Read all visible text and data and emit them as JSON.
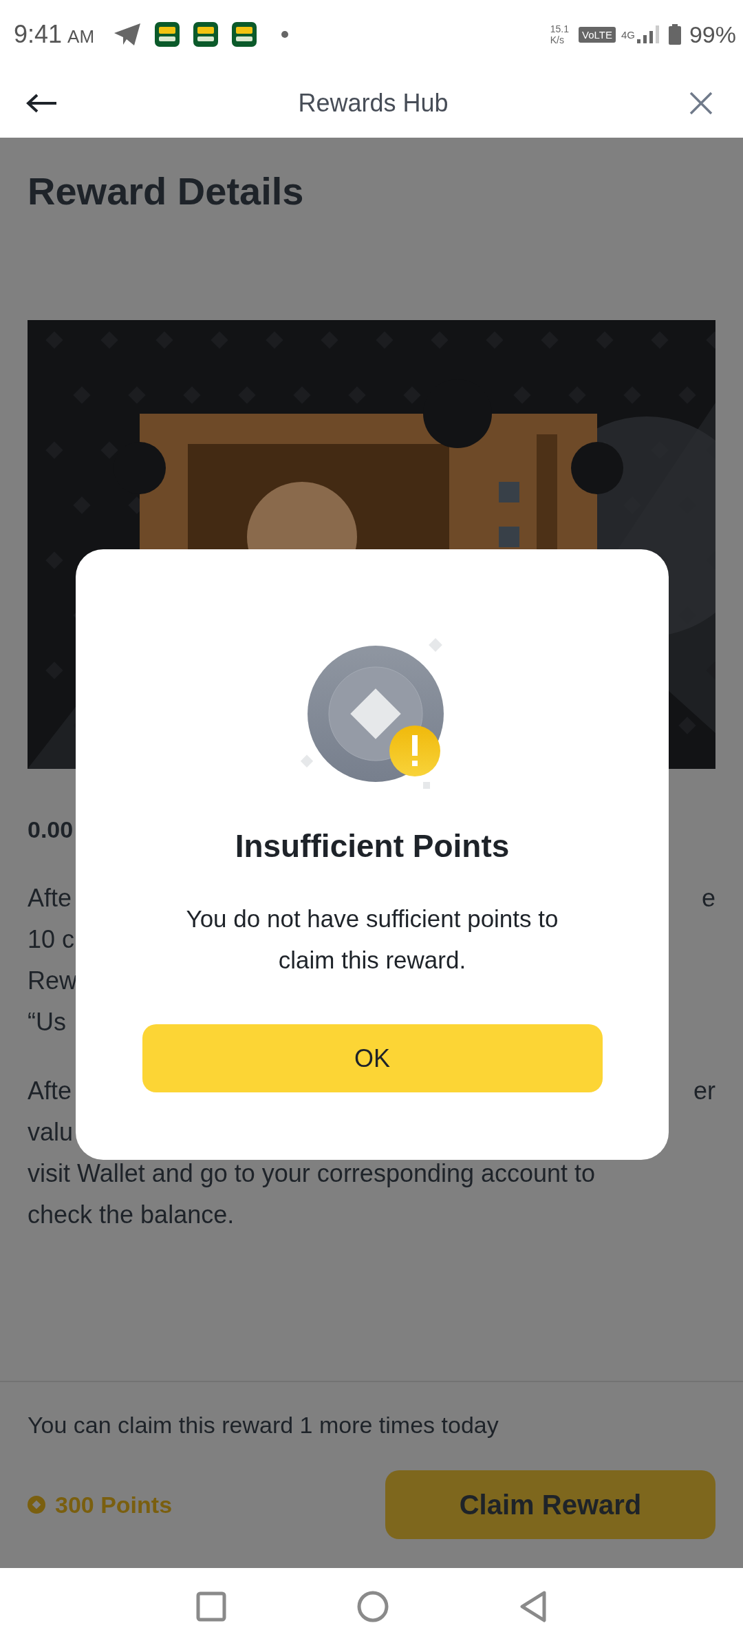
{
  "status_bar": {
    "time": "9:41",
    "am_pm": "AM",
    "speed_value": "15.1",
    "speed_unit": "K/s",
    "volte": "VoLTE",
    "network": "4G",
    "battery": "99%"
  },
  "header": {
    "title": "Rewards Hub"
  },
  "page": {
    "title": "Reward Details",
    "amount": "0.00",
    "paragraphs": [
      {
        "lines": [
          {
            "left": "Afte",
            "right": "e"
          },
          {
            "left": "10 c"
          },
          {
            "left": "Rew"
          },
          {
            "left": "“Us"
          }
        ]
      },
      {
        "lines": [
          {
            "left": "Afte",
            "right": "er"
          },
          {
            "left": "valu"
          },
          {
            "left": "visit Wallet and go to your corresponding account to"
          },
          {
            "left": "check the balance."
          }
        ]
      }
    ],
    "claim_note": "You can claim this reward 1 more times today",
    "points": "300 Points",
    "claim_button": "Claim Reward"
  },
  "dialog": {
    "title": "Insufficient Points",
    "message": "You do not have sufficient points to claim this reward.",
    "button": "OK"
  }
}
